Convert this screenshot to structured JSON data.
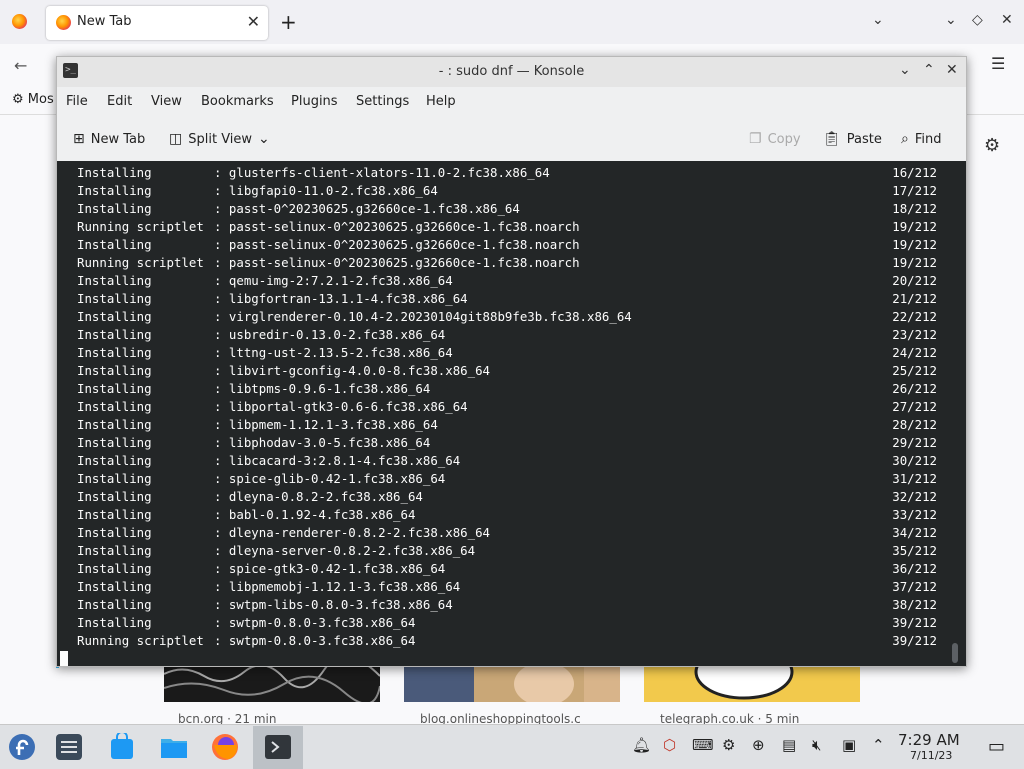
{
  "firefox": {
    "tab_title": "New Tab",
    "bookmark_item": "Mos",
    "cards": [
      {
        "source": "bcn.org · 21 min"
      },
      {
        "source": "blog.onlineshoppingtools.c"
      },
      {
        "source": "telegraph.co.uk · 5 min"
      }
    ]
  },
  "konsole": {
    "title": "- : sudo dnf — Konsole",
    "menu": [
      "File",
      "Edit",
      "View",
      "Bookmarks",
      "Plugins",
      "Settings",
      "Help"
    ],
    "toolbar": {
      "new_tab": "New Tab",
      "split_view": "Split View",
      "copy": "Copy",
      "paste": "Paste",
      "find": "Find"
    },
    "lines": [
      {
        "op": "Installing",
        "pkg": "glusterfs-client-xlators-11.0-2.fc38.x86_64",
        "count": "16/212"
      },
      {
        "op": "Installing",
        "pkg": "libgfapi0-11.0-2.fc38.x86_64",
        "count": "17/212"
      },
      {
        "op": "Installing",
        "pkg": "passt-0^20230625.g32660ce-1.fc38.x86_64",
        "count": "18/212"
      },
      {
        "op": "Running scriptlet",
        "pkg": "passt-selinux-0^20230625.g32660ce-1.fc38.noarch",
        "count": "19/212"
      },
      {
        "op": "Installing",
        "pkg": "passt-selinux-0^20230625.g32660ce-1.fc38.noarch",
        "count": "19/212"
      },
      {
        "op": "Running scriptlet",
        "pkg": "passt-selinux-0^20230625.g32660ce-1.fc38.noarch",
        "count": "19/212"
      },
      {
        "op": "Installing",
        "pkg": "qemu-img-2:7.2.1-2.fc38.x86_64",
        "count": "20/212"
      },
      {
        "op": "Installing",
        "pkg": "libgfortran-13.1.1-4.fc38.x86_64",
        "count": "21/212"
      },
      {
        "op": "Installing",
        "pkg": "virglrenderer-0.10.4-2.20230104git88b9fe3b.fc38.x86_64",
        "count": "22/212"
      },
      {
        "op": "Installing",
        "pkg": "usbredir-0.13.0-2.fc38.x86_64",
        "count": "23/212"
      },
      {
        "op": "Installing",
        "pkg": "lttng-ust-2.13.5-2.fc38.x86_64",
        "count": "24/212"
      },
      {
        "op": "Installing",
        "pkg": "libvirt-gconfig-4.0.0-8.fc38.x86_64",
        "count": "25/212"
      },
      {
        "op": "Installing",
        "pkg": "libtpms-0.9.6-1.fc38.x86_64",
        "count": "26/212"
      },
      {
        "op": "Installing",
        "pkg": "libportal-gtk3-0.6-6.fc38.x86_64",
        "count": "27/212"
      },
      {
        "op": "Installing",
        "pkg": "libpmem-1.12.1-3.fc38.x86_64",
        "count": "28/212"
      },
      {
        "op": "Installing",
        "pkg": "libphodav-3.0-5.fc38.x86_64",
        "count": "29/212"
      },
      {
        "op": "Installing",
        "pkg": "libcacard-3:2.8.1-4.fc38.x86_64",
        "count": "30/212"
      },
      {
        "op": "Installing",
        "pkg": "spice-glib-0.42-1.fc38.x86_64",
        "count": "31/212"
      },
      {
        "op": "Installing",
        "pkg": "dleyna-0.8.2-2.fc38.x86_64",
        "count": "32/212"
      },
      {
        "op": "Installing",
        "pkg": "babl-0.1.92-4.fc38.x86_64",
        "count": "33/212"
      },
      {
        "op": "Installing",
        "pkg": "dleyna-renderer-0.8.2-2.fc38.x86_64",
        "count": "34/212"
      },
      {
        "op": "Installing",
        "pkg": "dleyna-server-0.8.2-2.fc38.x86_64",
        "count": "35/212"
      },
      {
        "op": "Installing",
        "pkg": "spice-gtk3-0.42-1.fc38.x86_64",
        "count": "36/212"
      },
      {
        "op": "Installing",
        "pkg": "libpmemobj-1.12.1-3.fc38.x86_64",
        "count": "37/212"
      },
      {
        "op": "Installing",
        "pkg": "swtpm-libs-0.8.0-3.fc38.x86_64",
        "count": "38/212"
      },
      {
        "op": "Installing",
        "pkg": "swtpm-0.8.0-3.fc38.x86_64",
        "count": "39/212"
      },
      {
        "op": "Running scriptlet",
        "pkg": "swtpm-0.8.0-3.fc38.x86_64",
        "count": "39/212"
      }
    ]
  },
  "taskbar": {
    "time": "7:29 AM",
    "date": "7/11/23"
  },
  "colors": {
    "terminal_bg": "#232627",
    "terminal_fg": "#fcfcfc",
    "accent": "#3daee9"
  }
}
